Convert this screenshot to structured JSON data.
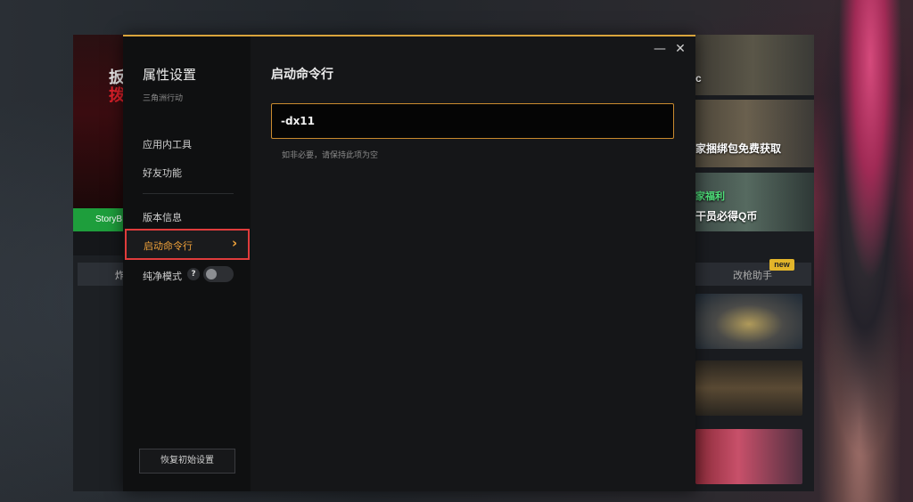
{
  "dialog": {
    "title": "属性设置",
    "subtitle": "三角洲行动",
    "minimize_icon": "—",
    "close_icon": "✕",
    "menu": {
      "app_tools": "应用内工具",
      "friends": "好友功能",
      "version_info": "版本信息",
      "launch_cmd": "启动命令行",
      "pure_mode": "纯净模式"
    },
    "help_icon": "?",
    "chevron_icon": "›",
    "pure_mode_enabled": false,
    "reset_button": "恢复初始设置",
    "content_title": "启动命令行",
    "command_value": "-dx11",
    "hint": "如非必要，请保持此项为空"
  },
  "launcher": {
    "left_promo_strip": "StoryB",
    "right_cards": [
      {
        "caption": "c"
      },
      {
        "caption": "家捆绑包免费获取"
      },
      {
        "caption": "干员必得Q币"
      }
    ],
    "right_card_tag": "家福利",
    "helper_tab": "改枪助手",
    "new_badge": "new"
  },
  "colors": {
    "accent_orange": "#f0a23a",
    "input_border": "#c98a2e",
    "dialog_top_border": "#d9a43c",
    "highlight_frame": "#e03c3c",
    "promo_green": "#1e9e3c"
  }
}
